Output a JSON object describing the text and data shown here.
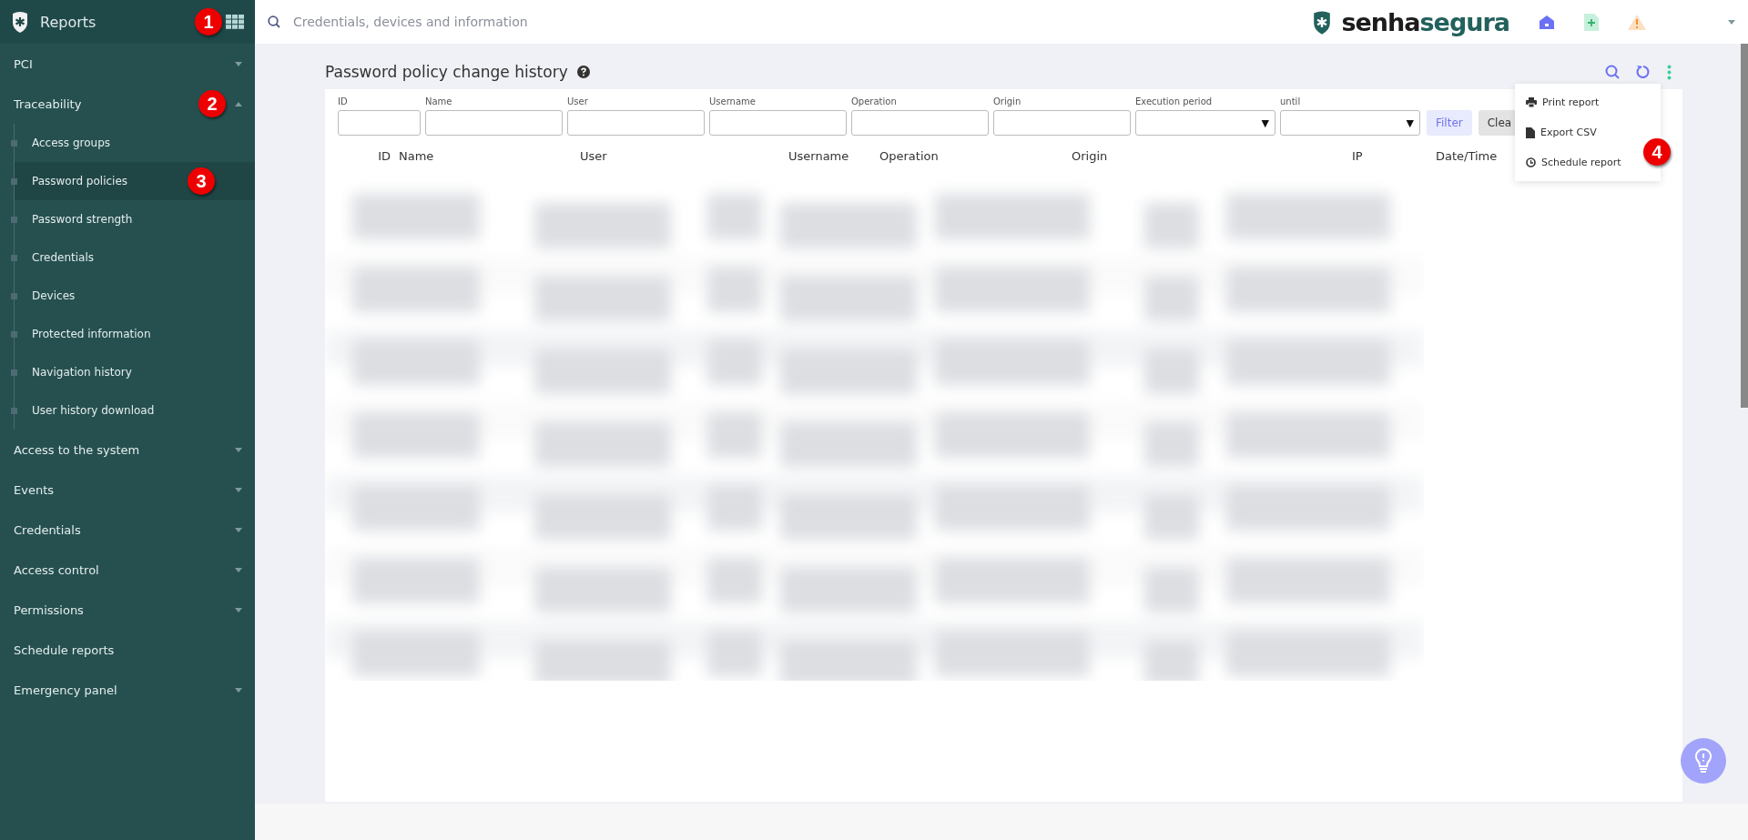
{
  "sidebar": {
    "title": "Reports",
    "marker": "1",
    "items": [
      {
        "kind": "group",
        "label": "PCI",
        "expanded": false
      },
      {
        "kind": "group",
        "label": "Traceability",
        "expanded": true,
        "marker": "2",
        "children": [
          {
            "label": "Access groups",
            "selected": false
          },
          {
            "label": "Password policies",
            "selected": true,
            "marker": "3"
          },
          {
            "label": "Password strength",
            "selected": false
          },
          {
            "label": "Credentials",
            "selected": false
          },
          {
            "label": "Devices",
            "selected": false
          },
          {
            "label": "Protected information",
            "selected": false
          },
          {
            "label": "Navigation history",
            "selected": false
          },
          {
            "label": "User history download",
            "selected": false
          }
        ]
      },
      {
        "kind": "group",
        "label": "Access to the system",
        "expanded": false
      },
      {
        "kind": "group",
        "label": "Events",
        "expanded": false
      },
      {
        "kind": "group",
        "label": "Credentials",
        "expanded": false
      },
      {
        "kind": "group",
        "label": "Access control",
        "expanded": false
      },
      {
        "kind": "group",
        "label": "Permissions",
        "expanded": false
      },
      {
        "kind": "link",
        "label": "Schedule reports"
      },
      {
        "kind": "group",
        "label": "Emergency panel",
        "expanded": false
      }
    ]
  },
  "topbar": {
    "search": {
      "placeholder": "Credentials, devices and information"
    },
    "logo": [
      "senha",
      "segura"
    ]
  },
  "page": {
    "title": "Password policy change history",
    "filters": [
      {
        "kind": "text",
        "label": "ID"
      },
      {
        "kind": "text",
        "label": "Name"
      },
      {
        "kind": "text",
        "label": "User"
      },
      {
        "kind": "text",
        "label": "Username"
      },
      {
        "kind": "text",
        "label": "Operation"
      },
      {
        "kind": "text",
        "label": "Origin"
      },
      {
        "kind": "select",
        "label": "Execution period",
        "caret": "▼"
      },
      {
        "kind": "select",
        "label": "until",
        "caret": "▼"
      }
    ],
    "buttons": [
      {
        "kind": "primary",
        "label": "Filter"
      },
      {
        "kind": "secondary",
        "label": "Clea"
      }
    ],
    "columns": [
      "ID",
      "Name",
      "User",
      "Username",
      "Operation",
      "Origin",
      "IP",
      "Date/Time"
    ],
    "menu": {
      "marker": "4",
      "items": [
        {
          "kind": "print",
          "label": "Print report"
        },
        {
          "kind": "file",
          "label": "Export CSV"
        },
        {
          "kind": "clock",
          "label": "Schedule report"
        }
      ]
    }
  }
}
